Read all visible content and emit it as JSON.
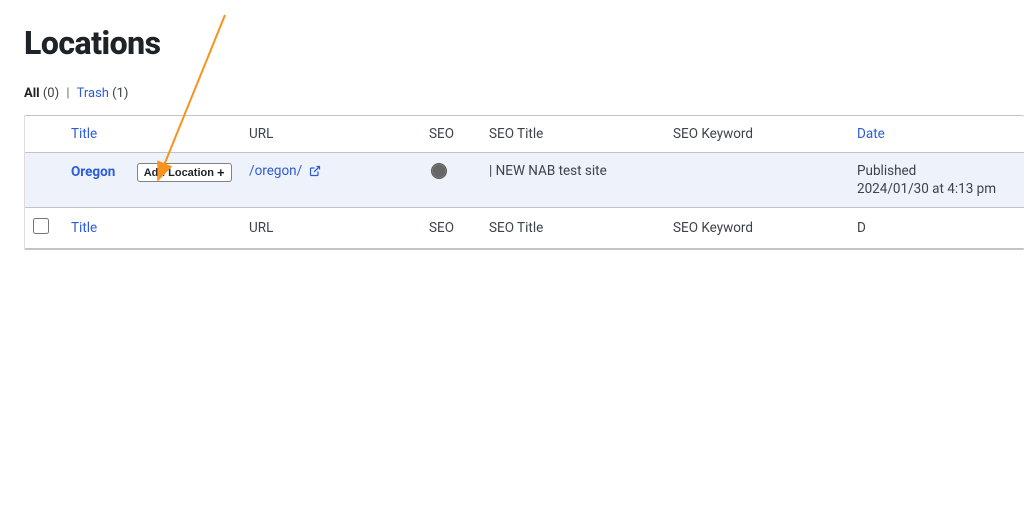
{
  "page": {
    "title": "Locations"
  },
  "filters": {
    "all_label": "All",
    "all_count": "(0)",
    "trash_label": "Trash",
    "trash_count": "(1)"
  },
  "columns": {
    "title": "Title",
    "url": "URL",
    "seo": "SEO",
    "seo_title": "SEO Title",
    "seo_keyword": "SEO Keyword",
    "date": "Date"
  },
  "row": {
    "title": "Oregon",
    "add_location_label": "Add Location",
    "url": "/oregon/",
    "seo_title": "| NEW NAB test site",
    "seo_keyword": "",
    "date_status": "Published",
    "date_timestamp": "2024/01/30 at 4:13 pm"
  },
  "footer": {
    "title": "Title",
    "url": "URL",
    "seo": "SEO",
    "seo_title": "SEO Title",
    "seo_keyword": "SEO Keyword",
    "date_first": "D"
  }
}
